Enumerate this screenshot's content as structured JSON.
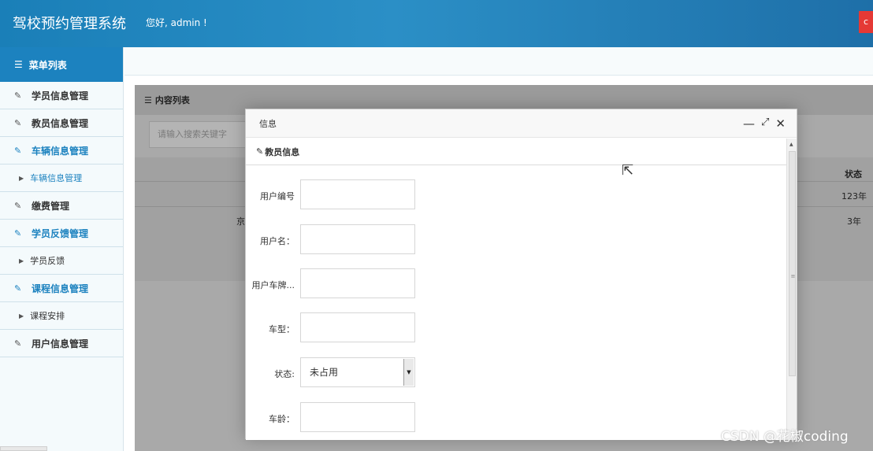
{
  "header": {
    "title": "驾校预约管理系统",
    "greeting": "您好, admin !",
    "logout_label": "c"
  },
  "sidebar": {
    "heading": "菜单列表",
    "items": [
      {
        "label": "学员信息管理",
        "type": "item",
        "active": false
      },
      {
        "label": "教员信息管理",
        "type": "item",
        "active": false
      },
      {
        "label": "车辆信息管理",
        "type": "item",
        "active": true
      },
      {
        "label": "车辆信息管理",
        "type": "sub",
        "active": true
      },
      {
        "label": "缴费管理",
        "type": "item",
        "active": false
      },
      {
        "label": "学员反馈管理",
        "type": "item",
        "active": true
      },
      {
        "label": "学员反馈",
        "type": "sub",
        "active": false
      },
      {
        "label": "课程信息管理",
        "type": "item",
        "active": true
      },
      {
        "label": "课程安排",
        "type": "sub",
        "active": false
      },
      {
        "label": "用户信息管理",
        "type": "item",
        "active": false
      }
    ]
  },
  "content": {
    "panel_title": "内容列表",
    "search_placeholder": "请输入搜索关键字",
    "table": {
      "status_header": "状态",
      "rows": [
        {
          "prefix": "",
          "status": "123年"
        },
        {
          "prefix": "京",
          "status": "3年"
        }
      ]
    }
  },
  "modal": {
    "title": "信息",
    "section_title": "教员信息",
    "fields": [
      {
        "label": "用户编号",
        "value": ""
      },
      {
        "label": "用户名：",
        "value": ""
      },
      {
        "label": "用户车牌...",
        "value": ""
      },
      {
        "label": "车型：",
        "value": ""
      },
      {
        "label": "状态:",
        "value": "未占用",
        "kind": "select"
      },
      {
        "label": "车龄：",
        "value": ""
      }
    ]
  },
  "watermark": "CSDN @花椒coding",
  "colors": {
    "header_blue": "#1c82bf",
    "active_text": "#1c82bf",
    "logout_red": "#e53935"
  }
}
